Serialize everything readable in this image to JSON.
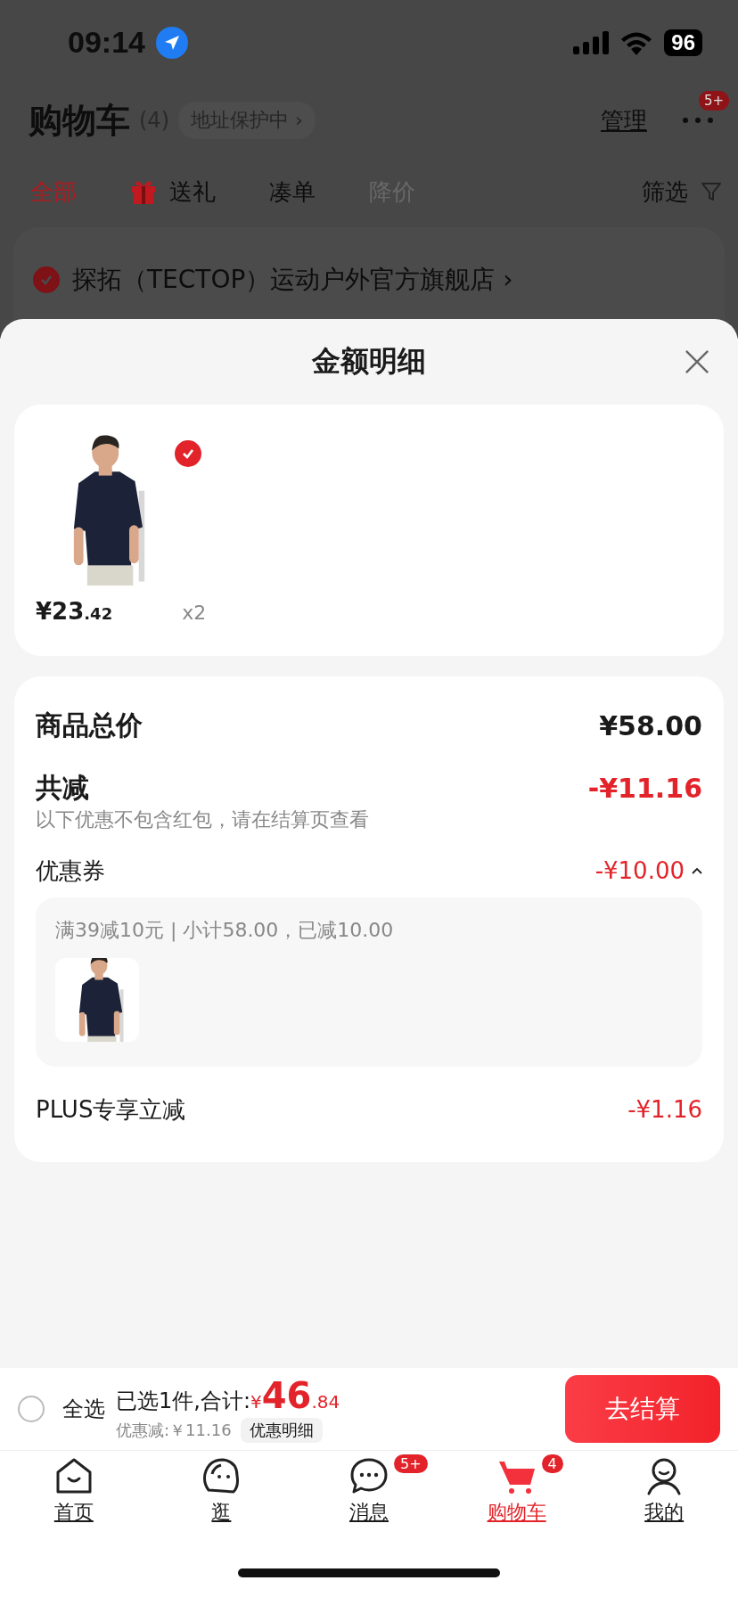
{
  "status_bar": {
    "time": "09:14",
    "battery": "96"
  },
  "header": {
    "title": "购物车",
    "count": "(4)",
    "address_badge": "地址保护中 ›",
    "manage": "管理",
    "more_badge": "5+"
  },
  "filter_tabs": [
    {
      "label": "全部",
      "kind": "text",
      "selected": true,
      "disabled": false
    },
    {
      "label": "送礼",
      "kind": "gift",
      "selected": false,
      "disabled": false
    },
    {
      "label": "凑单",
      "kind": "text",
      "selected": false,
      "disabled": false
    },
    {
      "label": "降价",
      "kind": "text",
      "selected": false,
      "disabled": true
    }
  ],
  "filter_button": {
    "label": "筛选"
  },
  "store": {
    "name": "探拓（TECTOP）运动户外官方旗舰店 ›",
    "checked": true
  },
  "sheet": {
    "title": "金额明细",
    "product": {
      "price_integer": "¥23",
      "price_decimal": ".42",
      "quantity": "x2",
      "checked": true
    },
    "rows": [
      {
        "kind": "total",
        "label": "商品总价",
        "amount": "¥58.00"
      },
      {
        "kind": "saving",
        "label": "共减",
        "amount": "-¥11.16",
        "note": "以下优惠不包含红包，请在结算页查看"
      },
      {
        "kind": "coupon",
        "label": "优惠券",
        "amount": "-¥10.00",
        "expanded": true,
        "detail": "满39减10元 | 小计58.00，已减10.00"
      },
      {
        "kind": "plus",
        "label": "PLUS专享立减",
        "amount": "-¥1.16"
      }
    ]
  },
  "bottom_bar": {
    "select_all": {
      "label": "全选",
      "checked": false
    },
    "summary": "已选1件,合计:",
    "currency": "¥",
    "total_integer": "46",
    "total_decimal": ".84",
    "discount": "优惠减:￥11.16",
    "details_button": "优惠明细",
    "checkout": "去结算"
  },
  "nav": [
    {
      "kind": "home",
      "label": "首页",
      "selected": false
    },
    {
      "kind": "discover",
      "label": "逛",
      "selected": false
    },
    {
      "kind": "messages",
      "label": "消息",
      "selected": false,
      "badge": "5+"
    },
    {
      "kind": "cart",
      "label": "购物车",
      "selected": true,
      "badge": "4"
    },
    {
      "kind": "profile",
      "label": "我的",
      "selected": false
    }
  ]
}
